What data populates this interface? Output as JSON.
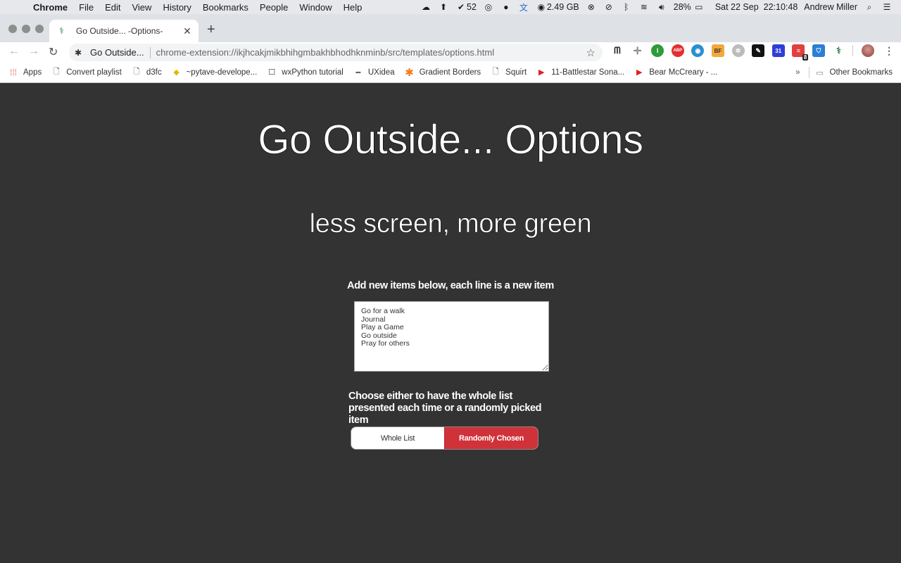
{
  "menubar": {
    "app": "Chrome",
    "items": [
      "File",
      "Edit",
      "View",
      "History",
      "Bookmarks",
      "People",
      "Window",
      "Help"
    ],
    "status": {
      "notification_count": "52",
      "memory": "2.49 GB",
      "battery": "28%",
      "datetime": "Sat 22 Sep  22:10:48",
      "user": "Andrew Miller"
    }
  },
  "browser": {
    "tab_title": "Go Outside... -Options-",
    "omnibox_site": "Go Outside...",
    "url": "chrome-extension://ikjhcakjmikbhihgmbakhbhodhknminb/src/templates/options.html",
    "extension_badge": "8",
    "extensions": [
      "ghostery",
      "move-tool",
      "instapaper",
      "adblock-plus",
      "lastpass-eye",
      "bf",
      "gray-ext",
      "signature",
      "calendar-31",
      "todoist",
      "bitwarden",
      "go-outside"
    ]
  },
  "bookmarks": {
    "items": [
      {
        "label": "Apps",
        "icon": "apps-grid-icon"
      },
      {
        "label": "Convert playlist",
        "icon": "page-icon"
      },
      {
        "label": "d3fc",
        "icon": "page-icon"
      },
      {
        "label": "~pytave-develope...",
        "icon": "warning-sign-icon"
      },
      {
        "label": "wxPython tutorial",
        "icon": "square-icon"
      },
      {
        "label": "UXidea",
        "icon": "uxidea-icon"
      },
      {
        "label": "Gradient Borders",
        "icon": "asterisk-icon"
      },
      {
        "label": "Squirt",
        "icon": "page-icon"
      },
      {
        "label": "11-Battlestar Sona...",
        "icon": "youtube-icon"
      },
      {
        "label": "Bear McCreary - ...",
        "icon": "youtube-icon"
      }
    ],
    "overflow": "»",
    "other": "Other Bookmarks"
  },
  "page": {
    "title": "Go Outside... Options",
    "subtitle": "less screen, more green",
    "items_label": "Add new items below, each line is a new item",
    "items_text": "Go for a walk\nJournal\nPlay a Game\nGo outside\nPray for others",
    "mode_label": "Choose either to have the whole list presented each time or a randomly picked item",
    "mode_options": [
      "Whole List",
      "Randomly Chosen"
    ],
    "mode_selected": "Randomly Chosen",
    "accent_color": "#d0323a",
    "background_color": "#333333"
  }
}
